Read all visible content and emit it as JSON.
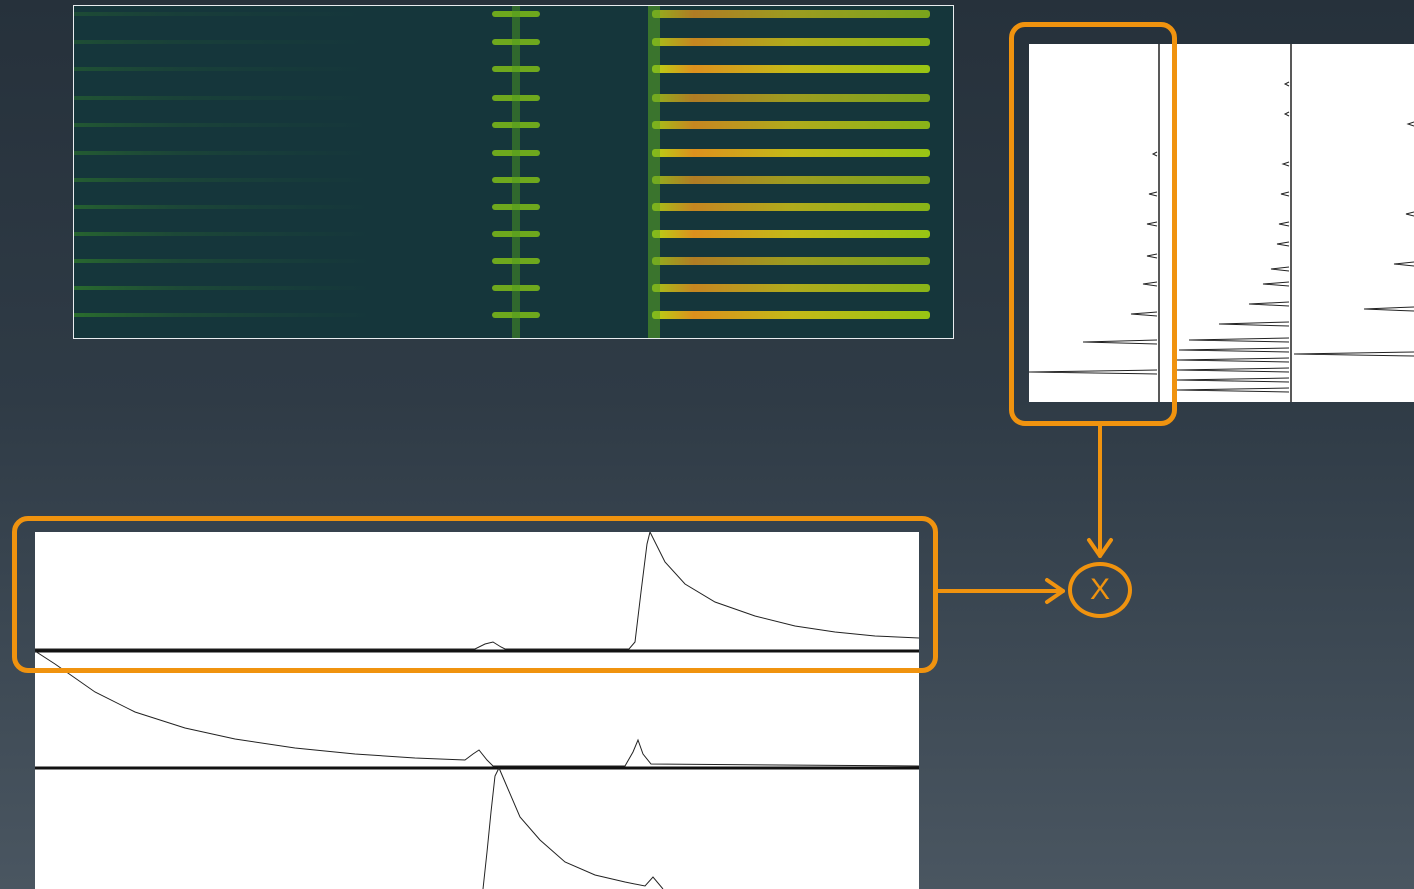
{
  "multiply_symbol": "X",
  "colors": {
    "background_top": "#26313b",
    "background_bottom": "#4a5661",
    "highlight": "#f0930f",
    "spectrogram_background": "#15363b",
    "spectrogram_band": "#9bd20f",
    "spectrogram_peak": "#f39a1a",
    "panel_background": "#ffffff",
    "trace": "#222222"
  },
  "spectrogram": {
    "band_count": 12,
    "onset_fraction": 0.67
  },
  "spectra": {
    "panel_count": 3
  },
  "envelopes": {
    "trace_count": 3
  }
}
